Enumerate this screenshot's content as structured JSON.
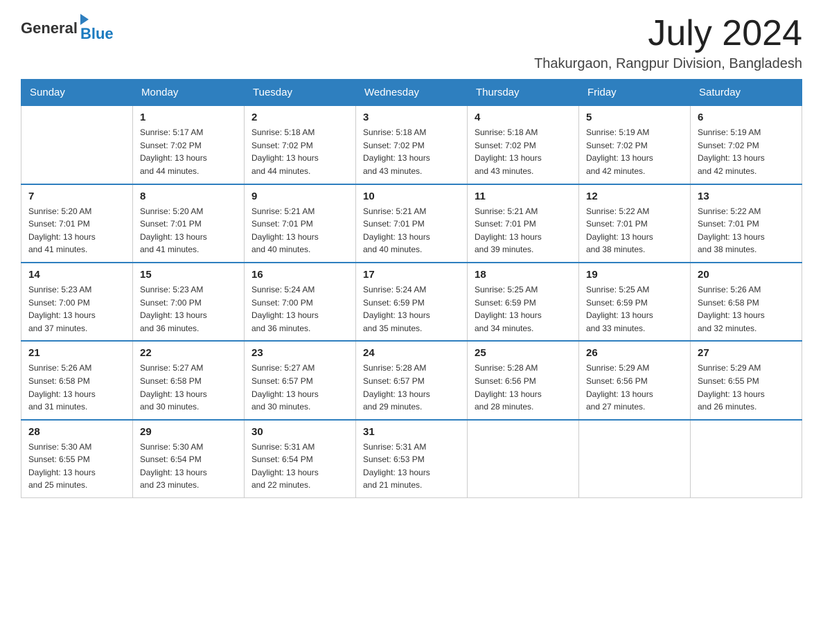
{
  "header": {
    "logo_general": "General",
    "logo_blue": "Blue",
    "month_year": "July 2024",
    "location": "Thakurgaon, Rangpur Division, Bangladesh"
  },
  "days_of_week": [
    "Sunday",
    "Monday",
    "Tuesday",
    "Wednesday",
    "Thursday",
    "Friday",
    "Saturday"
  ],
  "weeks": [
    [
      {
        "day": "",
        "info": ""
      },
      {
        "day": "1",
        "info": "Sunrise: 5:17 AM\nSunset: 7:02 PM\nDaylight: 13 hours\nand 44 minutes."
      },
      {
        "day": "2",
        "info": "Sunrise: 5:18 AM\nSunset: 7:02 PM\nDaylight: 13 hours\nand 44 minutes."
      },
      {
        "day": "3",
        "info": "Sunrise: 5:18 AM\nSunset: 7:02 PM\nDaylight: 13 hours\nand 43 minutes."
      },
      {
        "day": "4",
        "info": "Sunrise: 5:18 AM\nSunset: 7:02 PM\nDaylight: 13 hours\nand 43 minutes."
      },
      {
        "day": "5",
        "info": "Sunrise: 5:19 AM\nSunset: 7:02 PM\nDaylight: 13 hours\nand 42 minutes."
      },
      {
        "day": "6",
        "info": "Sunrise: 5:19 AM\nSunset: 7:02 PM\nDaylight: 13 hours\nand 42 minutes."
      }
    ],
    [
      {
        "day": "7",
        "info": "Sunrise: 5:20 AM\nSunset: 7:01 PM\nDaylight: 13 hours\nand 41 minutes."
      },
      {
        "day": "8",
        "info": "Sunrise: 5:20 AM\nSunset: 7:01 PM\nDaylight: 13 hours\nand 41 minutes."
      },
      {
        "day": "9",
        "info": "Sunrise: 5:21 AM\nSunset: 7:01 PM\nDaylight: 13 hours\nand 40 minutes."
      },
      {
        "day": "10",
        "info": "Sunrise: 5:21 AM\nSunset: 7:01 PM\nDaylight: 13 hours\nand 40 minutes."
      },
      {
        "day": "11",
        "info": "Sunrise: 5:21 AM\nSunset: 7:01 PM\nDaylight: 13 hours\nand 39 minutes."
      },
      {
        "day": "12",
        "info": "Sunrise: 5:22 AM\nSunset: 7:01 PM\nDaylight: 13 hours\nand 38 minutes."
      },
      {
        "day": "13",
        "info": "Sunrise: 5:22 AM\nSunset: 7:01 PM\nDaylight: 13 hours\nand 38 minutes."
      }
    ],
    [
      {
        "day": "14",
        "info": "Sunrise: 5:23 AM\nSunset: 7:00 PM\nDaylight: 13 hours\nand 37 minutes."
      },
      {
        "day": "15",
        "info": "Sunrise: 5:23 AM\nSunset: 7:00 PM\nDaylight: 13 hours\nand 36 minutes."
      },
      {
        "day": "16",
        "info": "Sunrise: 5:24 AM\nSunset: 7:00 PM\nDaylight: 13 hours\nand 36 minutes."
      },
      {
        "day": "17",
        "info": "Sunrise: 5:24 AM\nSunset: 6:59 PM\nDaylight: 13 hours\nand 35 minutes."
      },
      {
        "day": "18",
        "info": "Sunrise: 5:25 AM\nSunset: 6:59 PM\nDaylight: 13 hours\nand 34 minutes."
      },
      {
        "day": "19",
        "info": "Sunrise: 5:25 AM\nSunset: 6:59 PM\nDaylight: 13 hours\nand 33 minutes."
      },
      {
        "day": "20",
        "info": "Sunrise: 5:26 AM\nSunset: 6:58 PM\nDaylight: 13 hours\nand 32 minutes."
      }
    ],
    [
      {
        "day": "21",
        "info": "Sunrise: 5:26 AM\nSunset: 6:58 PM\nDaylight: 13 hours\nand 31 minutes."
      },
      {
        "day": "22",
        "info": "Sunrise: 5:27 AM\nSunset: 6:58 PM\nDaylight: 13 hours\nand 30 minutes."
      },
      {
        "day": "23",
        "info": "Sunrise: 5:27 AM\nSunset: 6:57 PM\nDaylight: 13 hours\nand 30 minutes."
      },
      {
        "day": "24",
        "info": "Sunrise: 5:28 AM\nSunset: 6:57 PM\nDaylight: 13 hours\nand 29 minutes."
      },
      {
        "day": "25",
        "info": "Sunrise: 5:28 AM\nSunset: 6:56 PM\nDaylight: 13 hours\nand 28 minutes."
      },
      {
        "day": "26",
        "info": "Sunrise: 5:29 AM\nSunset: 6:56 PM\nDaylight: 13 hours\nand 27 minutes."
      },
      {
        "day": "27",
        "info": "Sunrise: 5:29 AM\nSunset: 6:55 PM\nDaylight: 13 hours\nand 26 minutes."
      }
    ],
    [
      {
        "day": "28",
        "info": "Sunrise: 5:30 AM\nSunset: 6:55 PM\nDaylight: 13 hours\nand 25 minutes."
      },
      {
        "day": "29",
        "info": "Sunrise: 5:30 AM\nSunset: 6:54 PM\nDaylight: 13 hours\nand 23 minutes."
      },
      {
        "day": "30",
        "info": "Sunrise: 5:31 AM\nSunset: 6:54 PM\nDaylight: 13 hours\nand 22 minutes."
      },
      {
        "day": "31",
        "info": "Sunrise: 5:31 AM\nSunset: 6:53 PM\nDaylight: 13 hours\nand 21 minutes."
      },
      {
        "day": "",
        "info": ""
      },
      {
        "day": "",
        "info": ""
      },
      {
        "day": "",
        "info": ""
      }
    ]
  ]
}
